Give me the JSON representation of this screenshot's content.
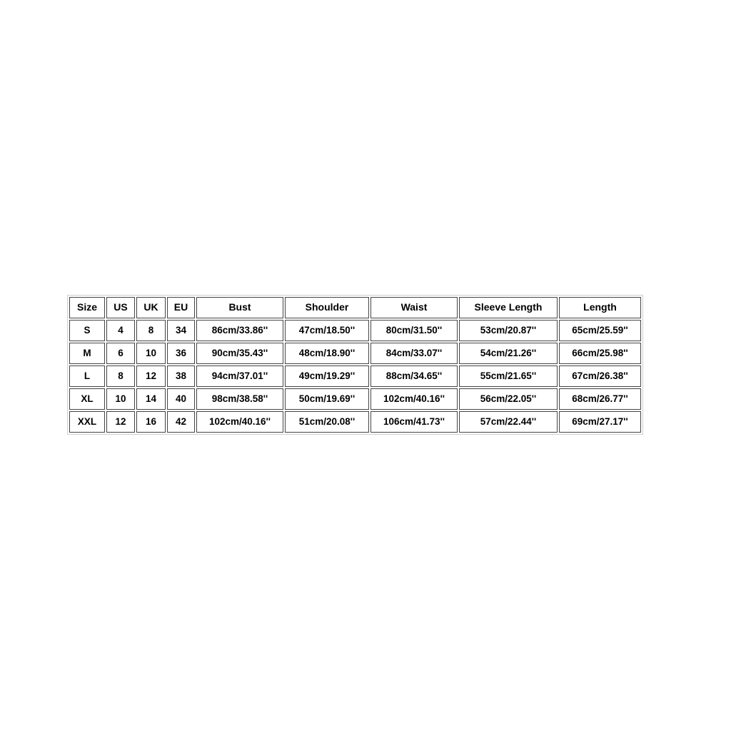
{
  "table": {
    "columns": [
      "Size",
      "US",
      "UK",
      "EU",
      "Bust",
      "Shoulder",
      "Waist",
      "Sleeve Length",
      "Length"
    ],
    "rows": [
      {
        "size": "S",
        "us": "4",
        "uk": "8",
        "eu": "34",
        "bust": "86cm/33.86''",
        "shoulder": "47cm/18.50''",
        "waist": "80cm/31.50''",
        "sleeve_length": "53cm/20.87''",
        "length": "65cm/25.59''"
      },
      {
        "size": "M",
        "us": "6",
        "uk": "10",
        "eu": "36",
        "bust": "90cm/35.43''",
        "shoulder": "48cm/18.90''",
        "waist": "84cm/33.07''",
        "sleeve_length": "54cm/21.26''",
        "length": "66cm/25.98''"
      },
      {
        "size": "L",
        "us": "8",
        "uk": "12",
        "eu": "38",
        "bust": "94cm/37.01''",
        "shoulder": "49cm/19.29''",
        "waist": "88cm/34.65''",
        "sleeve_length": "55cm/21.65''",
        "length": "67cm/26.38''"
      },
      {
        "size": "XL",
        "us": "10",
        "uk": "14",
        "eu": "40",
        "bust": "98cm/38.58''",
        "shoulder": "50cm/19.69''",
        "waist": "102cm/40.16''",
        "sleeve_length": "56cm/22.05''",
        "length": "68cm/26.77''"
      },
      {
        "size": "XXL",
        "us": "12",
        "uk": "16",
        "eu": "42",
        "bust": "102cm/40.16''",
        "shoulder": "51cm/20.08''",
        "waist": "106cm/41.73''",
        "sleeve_length": "57cm/22.44''",
        "length": "69cm/27.17''"
      }
    ]
  },
  "colors": {
    "page_background": "#ffffff",
    "cell_background": "#ffffff",
    "cell_border": "#444444",
    "outer_border": "#cfcfcf",
    "text": "#000000"
  }
}
